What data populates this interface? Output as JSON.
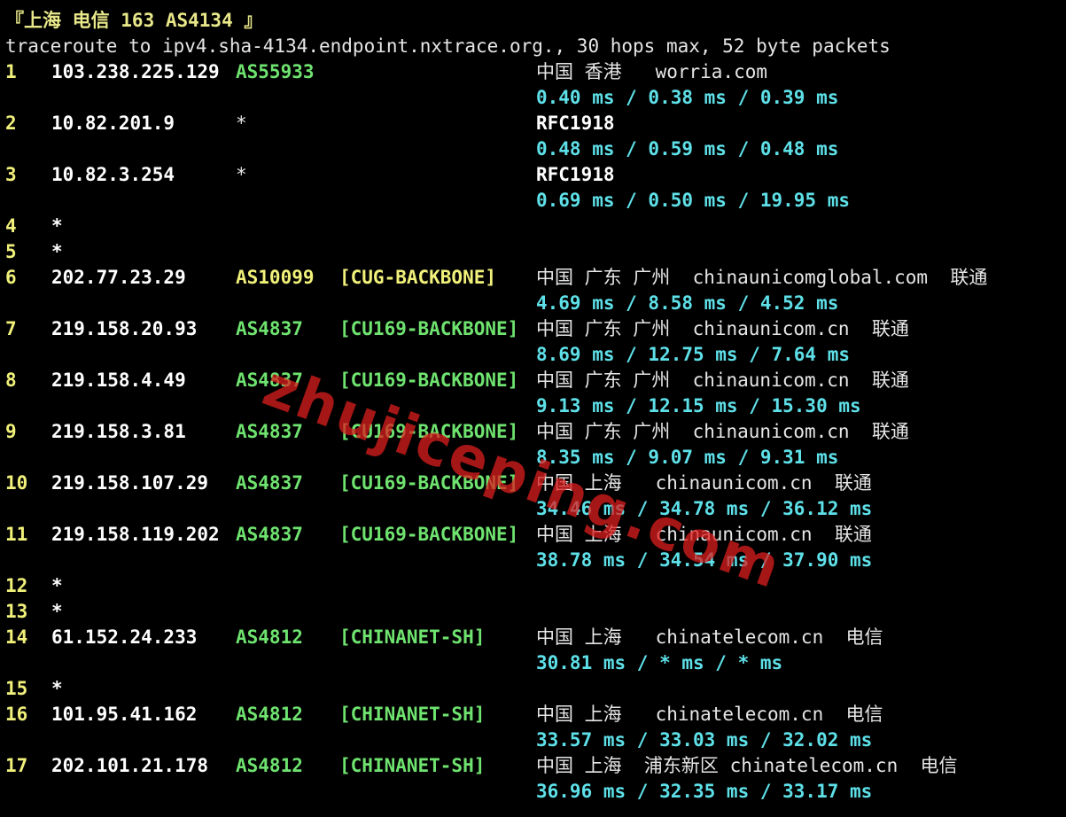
{
  "header": {
    "title": "『上海 电信 163 AS4134 』",
    "command": "traceroute to ipv4.sha-4134.endpoint.nxtrace.org., 30 hops max, 52 byte packets"
  },
  "hops": [
    {
      "n": "1",
      "ip": "103.238.225.129",
      "as": "AS55933",
      "tag": "",
      "geo": "中国 香港   worria.com",
      "rtt": "0.40 ms / 0.38 ms / 0.39 ms"
    },
    {
      "n": "2",
      "ip": "10.82.201.9",
      "as": "*",
      "tag": "",
      "geo": "RFC1918",
      "rtt": "0.48 ms / 0.59 ms / 0.48 ms"
    },
    {
      "n": "3",
      "ip": "10.82.3.254",
      "as": "*",
      "tag": "",
      "geo": "RFC1918",
      "rtt": "0.69 ms / 0.50 ms / 19.95 ms"
    },
    {
      "n": "4",
      "ip": "*"
    },
    {
      "n": "5",
      "ip": "*"
    },
    {
      "n": "6",
      "ip": "202.77.23.29",
      "as": "AS10099",
      "tag": "[CUG-BACKBONE]",
      "geo": "中国 广东 广州  chinaunicomglobal.com  联通",
      "rtt": "4.69 ms / 8.58 ms / 4.52 ms"
    },
    {
      "n": "7",
      "ip": "219.158.20.93",
      "as": "AS4837",
      "tag": "[CU169-BACKBONE]",
      "geo": "中国 广东 广州  chinaunicom.cn  联通",
      "rtt": "8.69 ms / 12.75 ms / 7.64 ms"
    },
    {
      "n": "8",
      "ip": "219.158.4.49",
      "as": "AS4837",
      "tag": "[CU169-BACKBONE]",
      "geo": "中国 广东 广州  chinaunicom.cn  联通",
      "rtt": "9.13 ms / 12.15 ms / 15.30 ms"
    },
    {
      "n": "9",
      "ip": "219.158.3.81",
      "as": "AS4837",
      "tag": "[CU169-BACKBONE]",
      "geo": "中国 广东 广州  chinaunicom.cn  联通",
      "rtt": "8.35 ms / 9.07 ms / 9.31 ms"
    },
    {
      "n": "10",
      "ip": "219.158.107.29",
      "as": "AS4837",
      "tag": "[CU169-BACKBONE]",
      "geo": "中国 上海   chinaunicom.cn  联通",
      "rtt": "34.46 ms / 34.78 ms / 36.12 ms"
    },
    {
      "n": "11",
      "ip": "219.158.119.202",
      "as": "AS4837",
      "tag": "[CU169-BACKBONE]",
      "geo": "中国 上海   chinaunicom.cn  联通",
      "rtt": "38.78 ms / 34.54 ms / 37.90 ms"
    },
    {
      "n": "12",
      "ip": "*"
    },
    {
      "n": "13",
      "ip": "*"
    },
    {
      "n": "14",
      "ip": "61.152.24.233",
      "as": "AS4812",
      "tag": "[CHINANET-SH]",
      "geo": "中国 上海   chinatelecom.cn  电信",
      "rtt": "30.81 ms / * ms / * ms"
    },
    {
      "n": "15",
      "ip": "*"
    },
    {
      "n": "16",
      "ip": "101.95.41.162",
      "as": "AS4812",
      "tag": "[CHINANET-SH]",
      "geo": "中国 上海   chinatelecom.cn  电信",
      "rtt": "33.57 ms / 33.03 ms / 32.02 ms"
    },
    {
      "n": "17",
      "ip": "202.101.21.178",
      "as": "AS4812",
      "tag": "[CHINANET-SH]",
      "geo": "中国 上海  浦东新区 chinatelecom.cn  电信",
      "rtt": "36.96 ms / 32.35 ms / 33.17 ms"
    }
  ],
  "watermark": "zhujiceping.com",
  "colors": {
    "hop_number": "#f0f07a",
    "asn": "#6fe36f",
    "asn_alt": "#f0f07a",
    "rtt": "#5ee0e8",
    "watermark": "#dc1e1e"
  }
}
